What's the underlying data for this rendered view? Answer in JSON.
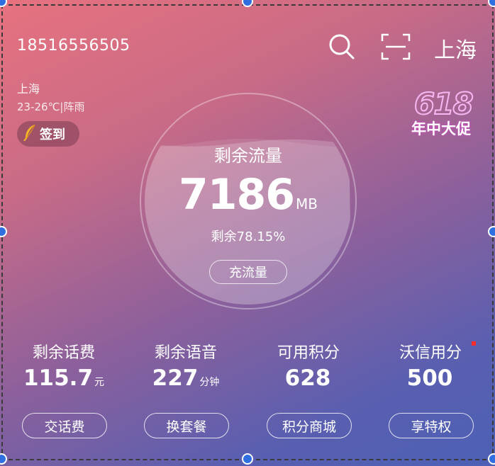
{
  "account": {
    "phone": "18516556505"
  },
  "header": {
    "city": "上海"
  },
  "weather": {
    "city": "上海",
    "info": "23-26℃|阵雨"
  },
  "checkin": {
    "label": "签到"
  },
  "promo": {
    "number": "618",
    "text": "年中大促"
  },
  "data_usage": {
    "title": "剩余流量",
    "value": "7186",
    "unit": "MB",
    "percent_text": "剩余78.15%",
    "fill_fraction": 0.7815,
    "topup_label": "充流量"
  },
  "stats": [
    {
      "label": "剩余话费",
      "value": "115.7",
      "unit": "元"
    },
    {
      "label": "剩余语音",
      "value": "227",
      "unit": "分钟"
    },
    {
      "label": "可用积分",
      "value": "628",
      "unit": ""
    },
    {
      "label": "沃信用分",
      "value": "500",
      "unit": ""
    }
  ],
  "actions": [
    {
      "label": "交话费"
    },
    {
      "label": "换套餐"
    },
    {
      "label": "积分商城"
    },
    {
      "label": "享特权"
    }
  ],
  "colors": {
    "gradient_top": "#e7727f",
    "gradient_bottom": "#4c60b5",
    "selection_handle": "#2f6fe0",
    "notice_dot": "#ff2a2a"
  }
}
